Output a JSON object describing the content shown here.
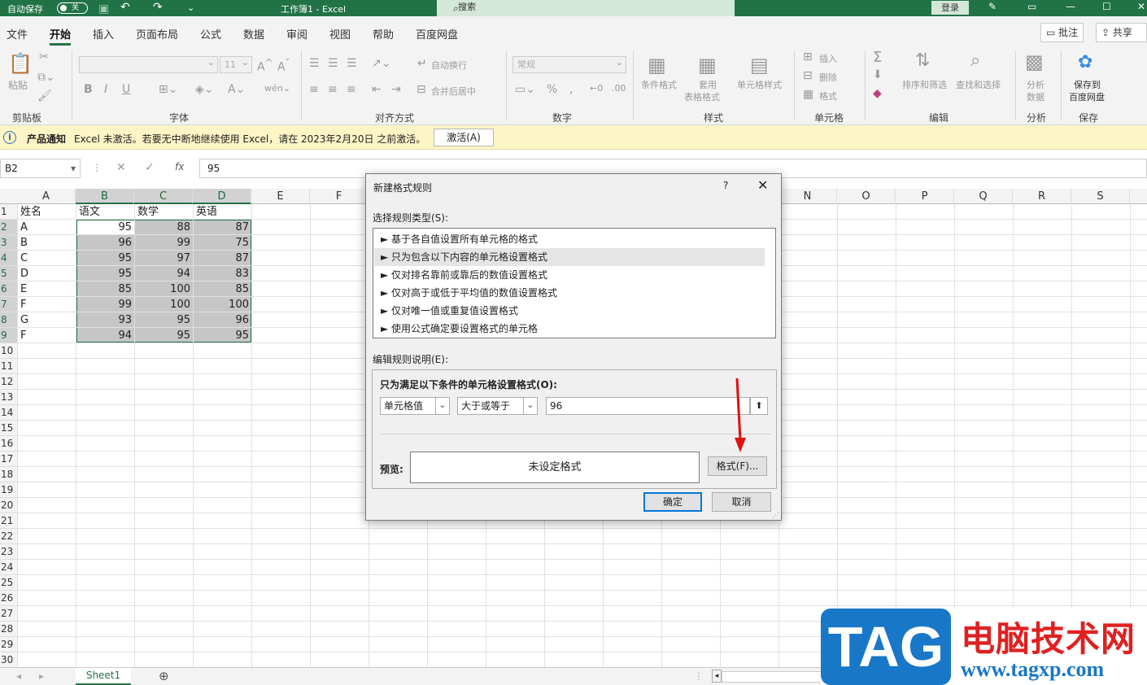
{
  "titlebar": {
    "autosave": "自动保存",
    "toggle": "关",
    "doc_title": "工作簿1 - Excel",
    "search": "搜索",
    "login": "登录"
  },
  "tabs": [
    "文件",
    "开始",
    "插入",
    "页面布局",
    "公式",
    "数据",
    "审阅",
    "视图",
    "帮助",
    "百度网盘"
  ],
  "active_tab": "开始",
  "top_buttons": {
    "comment": "批注",
    "share": "共享"
  },
  "ribbon": {
    "clipboard": {
      "label": "剪贴板",
      "paste": "粘贴"
    },
    "font": {
      "label": "字体",
      "size": "11",
      "bold": "B",
      "italic": "I",
      "underline": "U"
    },
    "alignment": {
      "label": "对齐方式",
      "wrap": "自动换行",
      "merge": "合并后居中"
    },
    "number": {
      "label": "数字",
      "format": "常规"
    },
    "styles": {
      "label": "样式",
      "cond": "条件格式",
      "table": "套用",
      "table2": "表格格式",
      "cell": "单元格样式"
    },
    "cells": {
      "label": "单元格",
      "insert": "插入",
      "delete": "删除",
      "format": "格式"
    },
    "editing": {
      "label": "编辑",
      "sort": "排序和筛选",
      "find": "查找和选择"
    },
    "analysis": {
      "label": "分析",
      "btn1": "分析",
      "btn2": "数据"
    },
    "save": {
      "label": "保存",
      "btn1": "保存到",
      "btn2": "百度网盘"
    }
  },
  "notice": {
    "title": "产品通知",
    "text": "Excel 未激活。若要无中断地继续使用 Excel，请在 2023年2月20日 之前激活。",
    "button": "激活(A)"
  },
  "formula_bar": {
    "name_box": "B2",
    "value": "95"
  },
  "columns": [
    "A",
    "B",
    "C",
    "D",
    "E",
    "F",
    "",
    "",
    "",
    "",
    "",
    "",
    "",
    "N",
    "O",
    "P",
    "Q",
    "R",
    "S"
  ],
  "rows": [
    "1",
    "2",
    "3",
    "4",
    "5",
    "6",
    "7",
    "8",
    "9",
    "10",
    "11",
    "12",
    "13",
    "14",
    "15",
    "16",
    "17",
    "18",
    "19",
    "20",
    "21",
    "22",
    "23",
    "24",
    "25",
    "26",
    "27",
    "28",
    "29",
    "30"
  ],
  "table": {
    "headers": [
      "姓名",
      "语文",
      "数学",
      "英语"
    ],
    "rows": [
      [
        "A",
        "95",
        "88",
        "87"
      ],
      [
        "B",
        "96",
        "99",
        "75"
      ],
      [
        "C",
        "95",
        "97",
        "87"
      ],
      [
        "D",
        "95",
        "94",
        "83"
      ],
      [
        "E",
        "85",
        "100",
        "85"
      ],
      [
        "F",
        "99",
        "100",
        "100"
      ],
      [
        "G",
        "93",
        "95",
        "96"
      ],
      [
        "F",
        "94",
        "95",
        "95"
      ]
    ]
  },
  "sheet_tab": "Sheet1",
  "dialog": {
    "title": "新建格式规则",
    "help": "?",
    "select_label": "选择规则类型(S):",
    "rule_types": [
      "► 基于各自值设置所有单元格的格式",
      "► 只为包含以下内容的单元格设置格式",
      "► 仅对排名靠前或靠后的数值设置格式",
      "► 仅对高于或低于平均值的数值设置格式",
      "► 仅对唯一值或重复值设置格式",
      "► 使用公式确定要设置格式的单元格"
    ],
    "selected_rule": 1,
    "edit_label": "编辑规则说明(E):",
    "condition_label": "只为满足以下条件的单元格设置格式(O):",
    "dropdown1": "单元格值",
    "dropdown2": "大于或等于",
    "value": "96",
    "preview_label": "预览:",
    "preview_text": "未设定格式",
    "format_button": "格式(F)...",
    "ok": "确定",
    "cancel": "取消"
  },
  "watermark": {
    "logo": "TAG",
    "cn": "电脑技术网",
    "url": "www.tagxp.com"
  }
}
